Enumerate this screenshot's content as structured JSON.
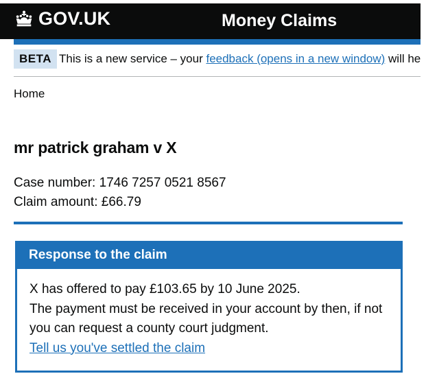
{
  "header": {
    "logo_text": "GOV.UK",
    "service_name": "Money Claims"
  },
  "phase_banner": {
    "tag": "BETA",
    "text_before": "This is a new service – your ",
    "link_text": "feedback (opens in a new window)",
    "text_after": " will help us to improve it."
  },
  "breadcrumb": {
    "home": "Home"
  },
  "case": {
    "title": "mr patrick graham v X",
    "case_number_label": "Case number: ",
    "case_number": "1746 7257 0521 8567",
    "claim_amount_label": "Claim amount: ",
    "claim_amount": "£66.79"
  },
  "response_panel": {
    "heading": "Response to the claim",
    "line1": "X has offered to pay £103.65 by 10 June 2025.",
    "line2": "The payment must be received in your account by then, if not you can request a county court judgment.",
    "link_text": "Tell us you've settled the claim"
  },
  "colors": {
    "header_bg": "#0b0c0c",
    "brand_blue": "#1d70b8",
    "tag_bg": "#d2e2f1",
    "text": "#0b0c0c"
  },
  "icons": {
    "logo": "crown-icon"
  }
}
